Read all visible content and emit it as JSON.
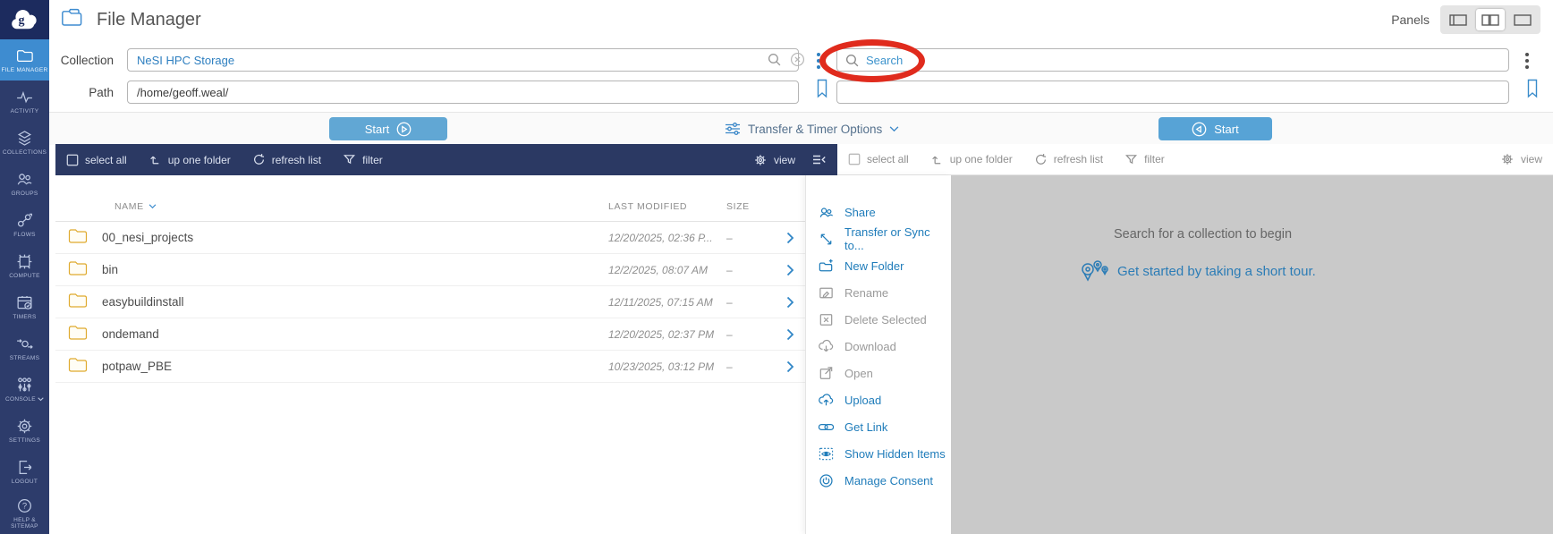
{
  "colors": {
    "accent_blue": "#3e8cd0",
    "navy": "#2b3963",
    "link_blue": "#1f7cba",
    "folder_yellow": "#dfaa2e",
    "annotation_red": "#e02b1d",
    "panel_gray": "#c9c9c9"
  },
  "header": {
    "title": "File Manager",
    "panels_label": "Panels",
    "panel_buttons": [
      "left-collapsed-layout",
      "dual-panel-layout",
      "single-panel-layout"
    ],
    "active_panel_button": "dual-panel-layout"
  },
  "sidebar": {
    "logo": "globus-logo",
    "items": [
      {
        "label": "FILE MANAGER",
        "active": true
      },
      {
        "label": "ACTIVITY"
      },
      {
        "label": "COLLECTIONS"
      },
      {
        "label": "GROUPS"
      },
      {
        "label": "FLOWS"
      },
      {
        "label": "COMPUTE"
      },
      {
        "label": "TIMERS"
      },
      {
        "label": "STREAMS"
      },
      {
        "label": "CONSOLE"
      },
      {
        "label": "SETTINGS"
      },
      {
        "label": "LOGOUT"
      },
      {
        "label": "HELP & SITEMAP"
      }
    ]
  },
  "left_panel": {
    "collection_label": "Collection",
    "collection_value": "NeSI HPC Storage",
    "path_label": "Path",
    "path_value": "/home/geoff.weal/",
    "start_label": "Start",
    "toolbar": {
      "select_all": "select all",
      "up_one_folder": "up one folder",
      "refresh_list": "refresh list",
      "filter": "filter",
      "view": "view"
    },
    "table": {
      "columns": {
        "name": "NAME",
        "modified": "LAST MODIFIED",
        "size": "SIZE"
      },
      "rows": [
        {
          "name": "00_nesi_projects",
          "modified": "12/20/2025, 02:36 P...",
          "size": "–"
        },
        {
          "name": "bin",
          "modified": "12/2/2025, 08:07 AM",
          "size": "–"
        },
        {
          "name": "easybuildinstall",
          "modified": "12/11/2025, 07:15 AM",
          "size": "–"
        },
        {
          "name": "ondemand",
          "modified": "12/20/2025, 02:37 PM",
          "size": "–"
        },
        {
          "name": "potpaw_PBE",
          "modified": "10/23/2025, 03:12 PM",
          "size": "–"
        }
      ]
    }
  },
  "transfer_options": {
    "label": "Transfer & Timer Options"
  },
  "right_panel": {
    "search_placeholder": "Search",
    "path_value": "",
    "start_label": "Start",
    "toolbar": {
      "select_all": "select all",
      "up_one_folder": "up one folder",
      "refresh_list": "refresh list",
      "filter": "filter",
      "view": "view"
    },
    "empty_state": {
      "message": "Search for a collection to begin",
      "tour_link": "Get started by taking a short tour."
    }
  },
  "context_menu": {
    "items": [
      {
        "label": "Share",
        "enabled": true
      },
      {
        "label": "Transfer or Sync to...",
        "enabled": true
      },
      {
        "label": "New Folder",
        "enabled": true
      },
      {
        "label": "Rename",
        "enabled": false
      },
      {
        "label": "Delete Selected",
        "enabled": false
      },
      {
        "label": "Download",
        "enabled": false
      },
      {
        "label": "Open",
        "enabled": false
      },
      {
        "label": "Upload",
        "enabled": true
      },
      {
        "label": "Get Link",
        "enabled": true
      },
      {
        "label": "Show Hidden Items",
        "enabled": true
      },
      {
        "label": "Manage Consent",
        "enabled": true
      }
    ]
  }
}
